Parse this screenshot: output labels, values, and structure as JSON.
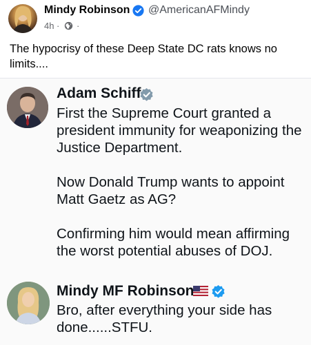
{
  "post": {
    "author_name": "Mindy Robinson",
    "author_handle": "@AmericanAFMindy",
    "time": "4h",
    "separator": "·",
    "text": "The hypocrisy of these Deep State DC rats knows no limits...."
  },
  "embed": {
    "tweets": [
      {
        "name": "Adam Schiff",
        "verified": true,
        "body": "First the Supreme Court granted a president immunity for weaponizing the Justice Department.\n\nNow Donald Trump wants to appoint Matt Gaetz as AG?\n\nConfirming him would mean affirming the worst potential abuses of DOJ."
      },
      {
        "name": "Mindy MF Robinson",
        "verified": true,
        "flag": "us-flag",
        "body": "Bro, after everything your side has done......STFU."
      }
    ]
  },
  "colors": {
    "verified_blue": "#1d9bf0",
    "meta_gray": "#65676b"
  }
}
